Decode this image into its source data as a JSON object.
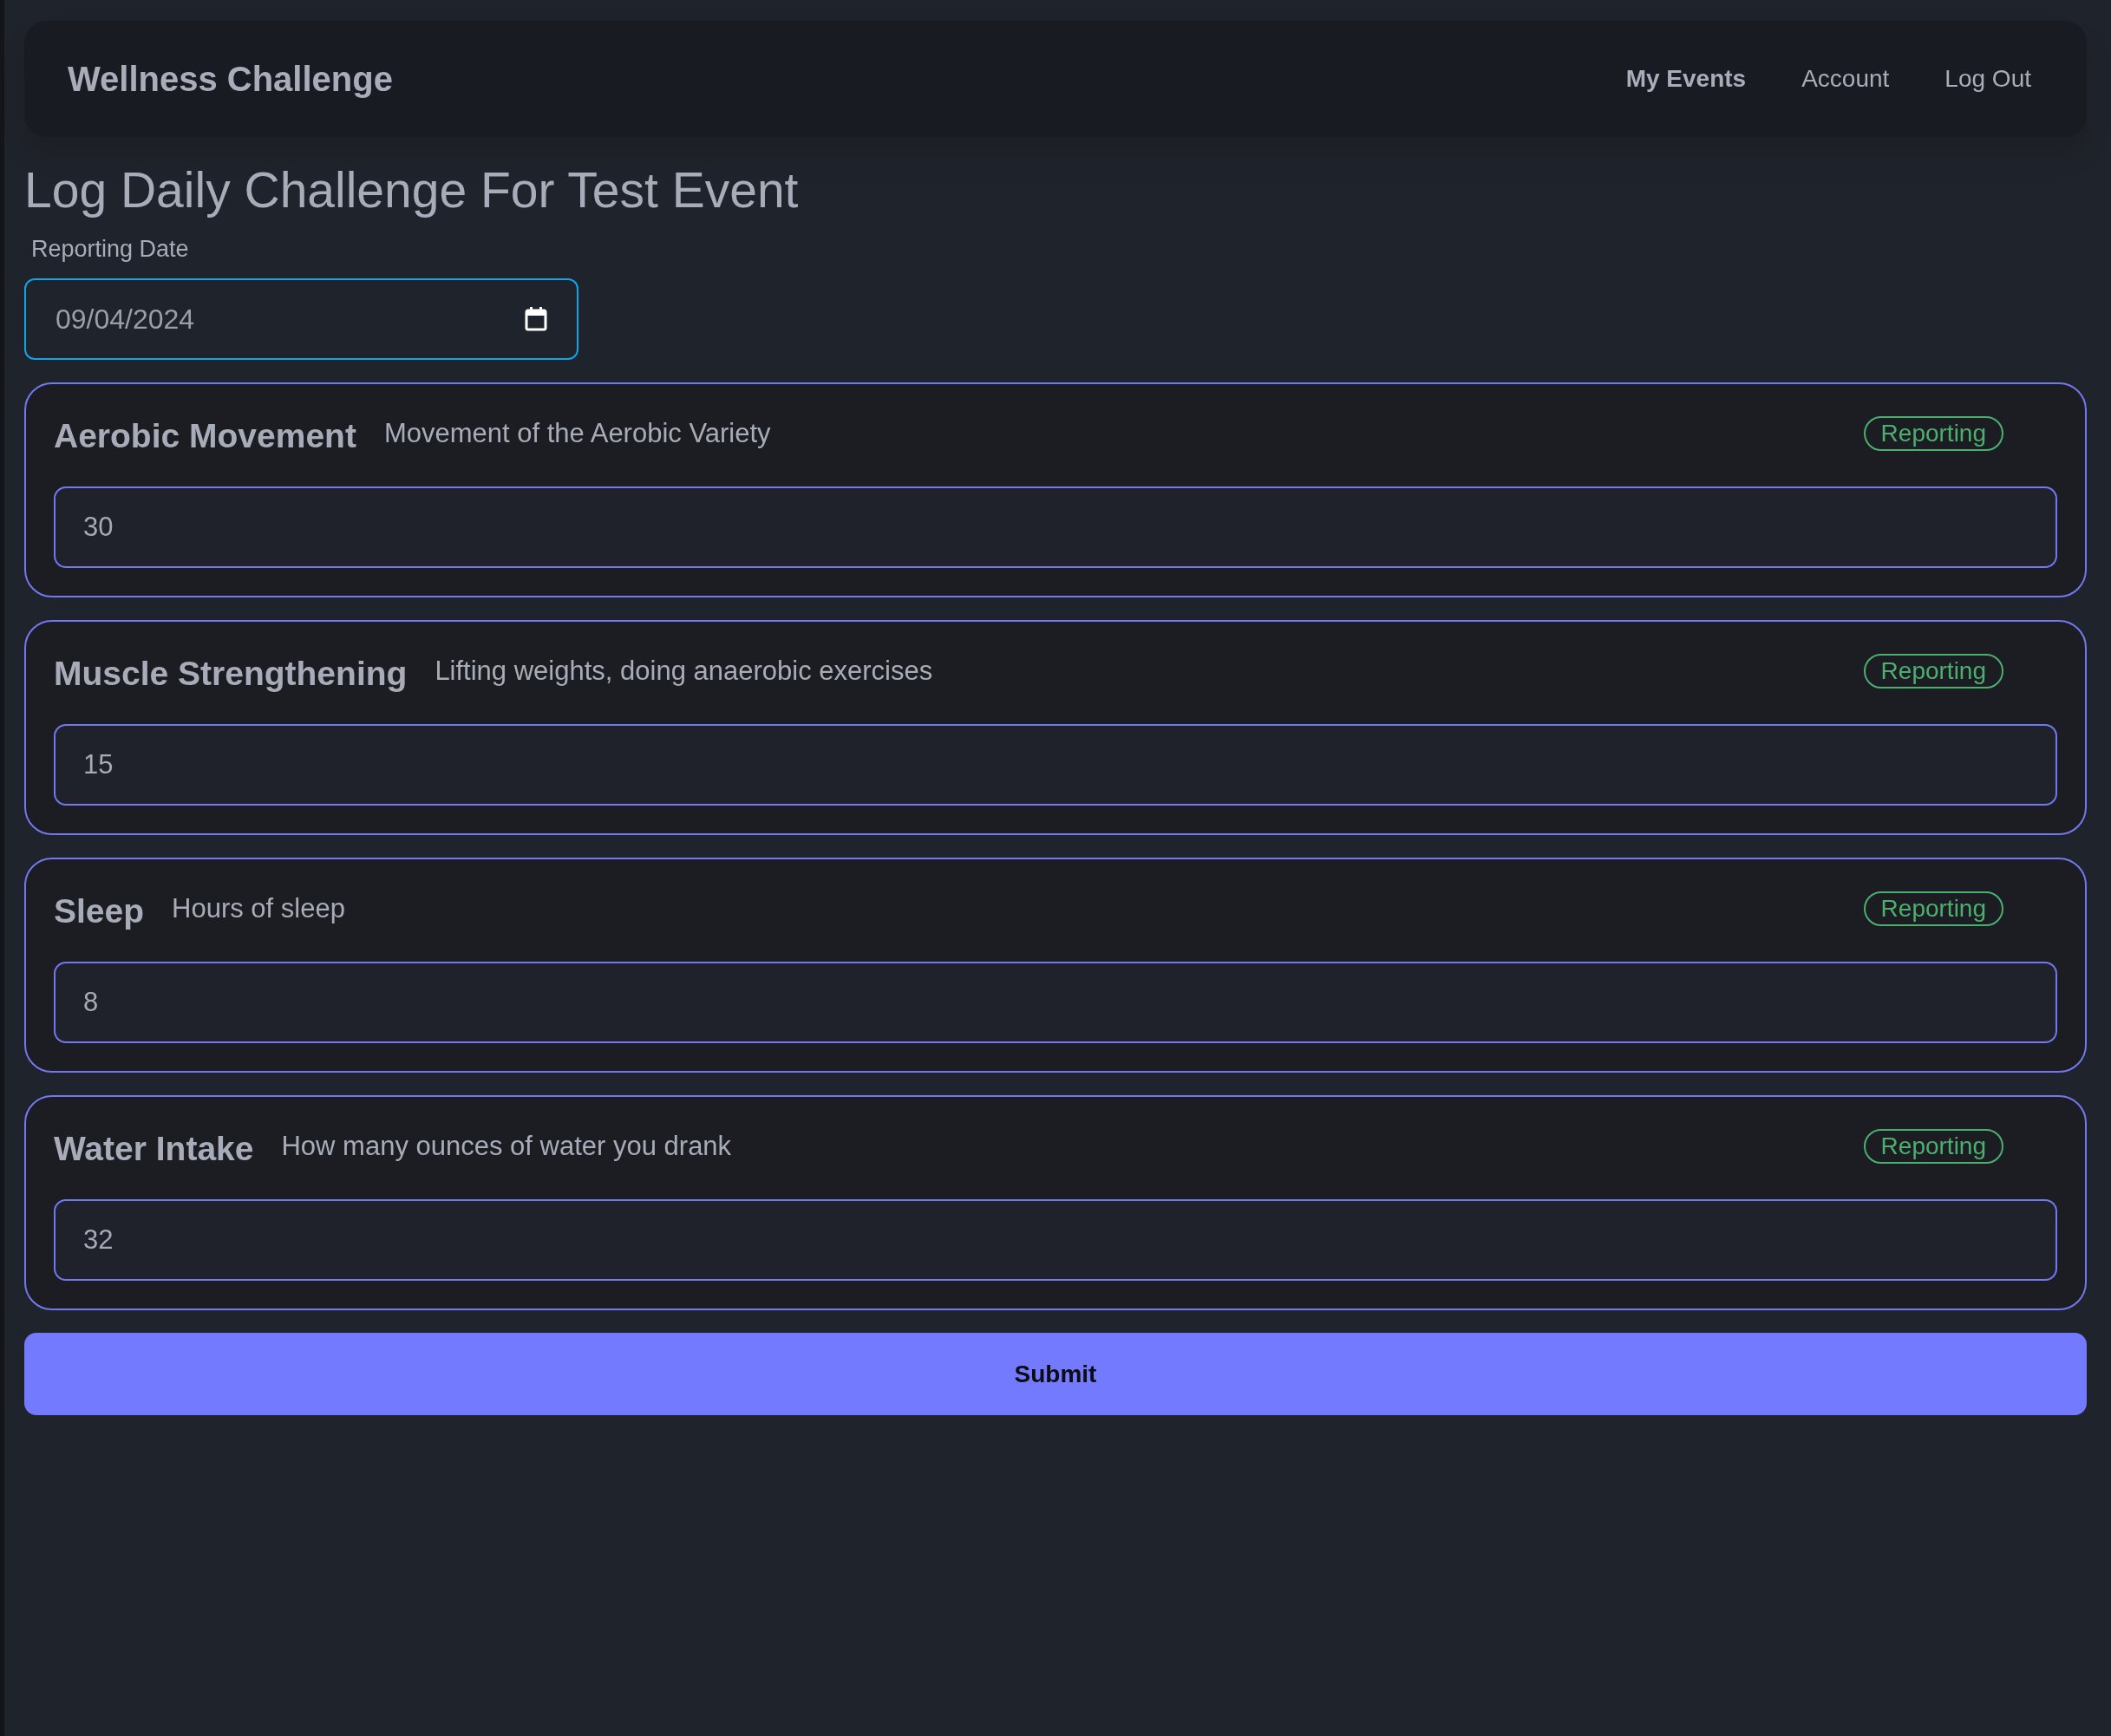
{
  "navbar": {
    "brand": "Wellness Challenge",
    "links": [
      {
        "label": "My Events",
        "selected": true
      },
      {
        "label": "Account",
        "selected": false
      },
      {
        "label": "Log Out",
        "selected": false
      }
    ]
  },
  "page_title": "Log Daily Challenge For Test Event",
  "date_field": {
    "label": "Reporting Date",
    "value": "09/04/2024"
  },
  "challenges": [
    {
      "name": "Aerobic Movement",
      "description": "Movement of the Aerobic Variety",
      "status": "Reporting",
      "value": "30"
    },
    {
      "name": "Muscle Strengthening",
      "description": "Lifting weights, doing anaerobic exercises",
      "status": "Reporting",
      "value": "15"
    },
    {
      "name": "Sleep",
      "description": "Hours of sleep",
      "status": "Reporting",
      "value": "8"
    },
    {
      "name": "Water Intake",
      "description": "How many ounces of water you drank",
      "status": "Reporting",
      "value": "32"
    }
  ],
  "submit_button": "Submit"
}
